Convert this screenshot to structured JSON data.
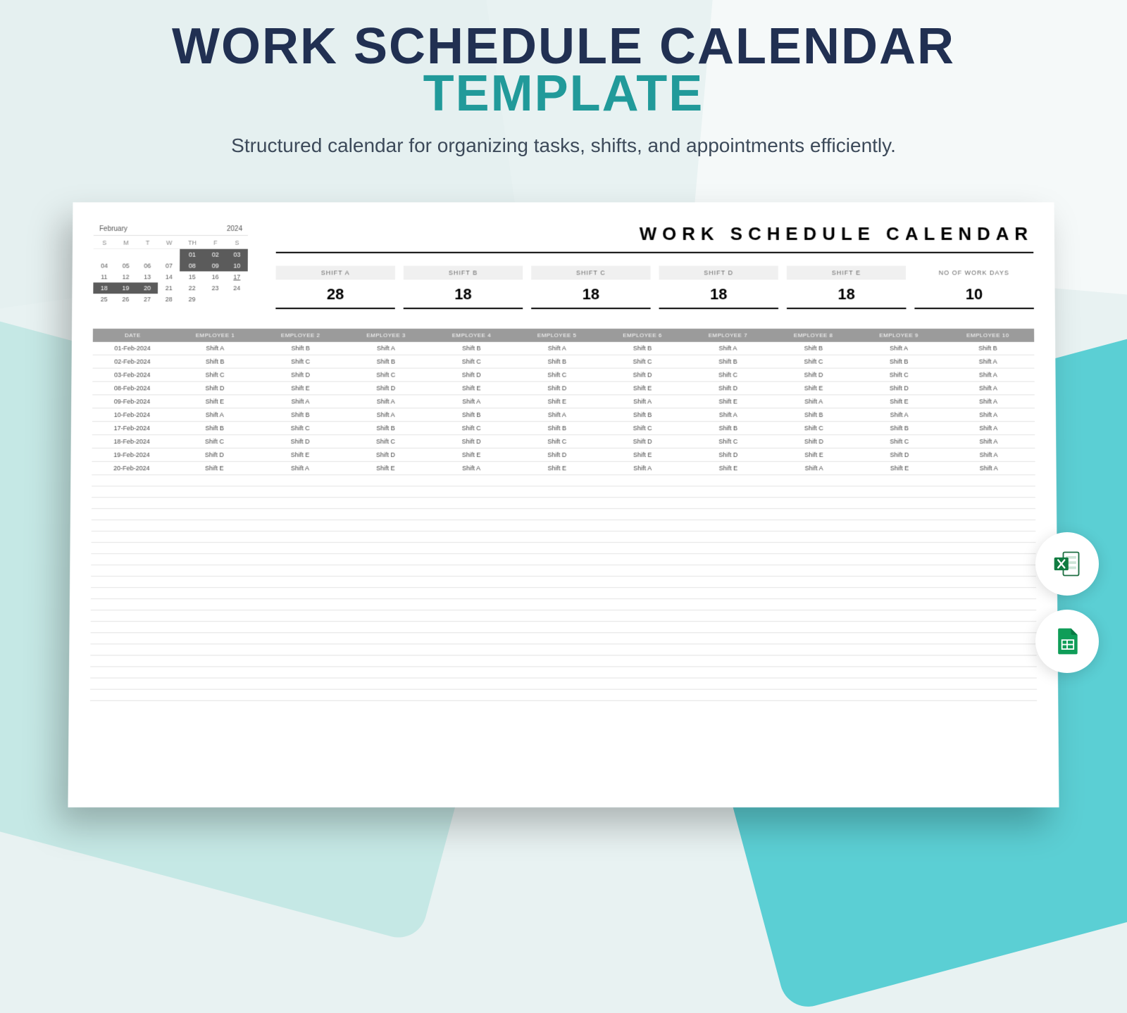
{
  "hero": {
    "line1": "WORK SCHEDULE CALENDAR",
    "line2": "TEMPLATE",
    "subtitle": "Structured calendar for organizing tasks, shifts, and appointments efficiently."
  },
  "mini_calendar": {
    "month": "February",
    "year": "2024",
    "days": [
      "S",
      "M",
      "T",
      "W",
      "TH",
      "F",
      "S"
    ],
    "weeks": [
      [
        {
          "t": ""
        },
        {
          "t": ""
        },
        {
          "t": ""
        },
        {
          "t": ""
        },
        {
          "t": "01",
          "d": true
        },
        {
          "t": "02",
          "d": true
        },
        {
          "t": "03",
          "d": true
        }
      ],
      [
        {
          "t": "04"
        },
        {
          "t": "05"
        },
        {
          "t": "06"
        },
        {
          "t": "07"
        },
        {
          "t": "08",
          "d": true
        },
        {
          "t": "09",
          "d": true
        },
        {
          "t": "10",
          "d": true
        }
      ],
      [
        {
          "t": "11"
        },
        {
          "t": "12"
        },
        {
          "t": "13"
        },
        {
          "t": "14"
        },
        {
          "t": "15"
        },
        {
          "t": "16"
        },
        {
          "t": "17",
          "u": true
        }
      ],
      [
        {
          "t": "18",
          "d": true
        },
        {
          "t": "19",
          "d": true
        },
        {
          "t": "20",
          "d": true
        },
        {
          "t": "21"
        },
        {
          "t": "22"
        },
        {
          "t": "23"
        },
        {
          "t": "24"
        }
      ],
      [
        {
          "t": "25"
        },
        {
          "t": "26"
        },
        {
          "t": "27"
        },
        {
          "t": "28"
        },
        {
          "t": "29"
        },
        {
          "t": ""
        },
        {
          "t": ""
        }
      ]
    ]
  },
  "summary": {
    "title": "WORK SCHEDULE CALENDAR",
    "boxes": [
      {
        "label": "SHIFT A",
        "value": "28"
      },
      {
        "label": "SHIFT B",
        "value": "18"
      },
      {
        "label": "SHIFT C",
        "value": "18"
      },
      {
        "label": "SHIFT D",
        "value": "18"
      },
      {
        "label": "SHIFT E",
        "value": "18"
      },
      {
        "label": "NO OF WORK DAYS",
        "value": "10"
      }
    ]
  },
  "schedule": {
    "headers": [
      "DATE",
      "EMPLOYEE 1",
      "EMPLOYEE 2",
      "EMPLOYEE 3",
      "EMPLOYEE 4",
      "EMPLOYEE 5",
      "EMPLOYEE 6",
      "EMPLOYEE 7",
      "EMPLOYEE 8",
      "EMPLOYEE 9",
      "EMPLOYEE 10"
    ],
    "rows": [
      [
        "01-Feb-2024",
        "Shift A",
        "Shift B",
        "Shift A",
        "Shift B",
        "Shift A",
        "Shift B",
        "Shift A",
        "Shift B",
        "Shift A",
        "Shift B"
      ],
      [
        "02-Feb-2024",
        "Shift B",
        "Shift C",
        "Shift B",
        "Shift C",
        "Shift B",
        "Shift C",
        "Shift B",
        "Shift C",
        "Shift B",
        "Shift A"
      ],
      [
        "03-Feb-2024",
        "Shift C",
        "Shift D",
        "Shift C",
        "Shift D",
        "Shift C",
        "Shift D",
        "Shift C",
        "Shift D",
        "Shift C",
        "Shift A"
      ],
      [
        "08-Feb-2024",
        "Shift D",
        "Shift E",
        "Shift D",
        "Shift E",
        "Shift D",
        "Shift E",
        "Shift D",
        "Shift E",
        "Shift D",
        "Shift A"
      ],
      [
        "09-Feb-2024",
        "Shift E",
        "Shift A",
        "Shift A",
        "Shift A",
        "Shift E",
        "Shift A",
        "Shift E",
        "Shift A",
        "Shift E",
        "Shift A"
      ],
      [
        "10-Feb-2024",
        "Shift A",
        "Shift B",
        "Shift A",
        "Shift B",
        "Shift A",
        "Shift B",
        "Shift A",
        "Shift B",
        "Shift A",
        "Shift A"
      ],
      [
        "17-Feb-2024",
        "Shift B",
        "Shift C",
        "Shift B",
        "Shift C",
        "Shift B",
        "Shift C",
        "Shift B",
        "Shift C",
        "Shift B",
        "Shift A"
      ],
      [
        "18-Feb-2024",
        "Shift C",
        "Shift D",
        "Shift C",
        "Shift D",
        "Shift C",
        "Shift D",
        "Shift C",
        "Shift D",
        "Shift C",
        "Shift A"
      ],
      [
        "19-Feb-2024",
        "Shift D",
        "Shift E",
        "Shift D",
        "Shift E",
        "Shift D",
        "Shift E",
        "Shift D",
        "Shift E",
        "Shift D",
        "Shift A"
      ],
      [
        "20-Feb-2024",
        "Shift E",
        "Shift A",
        "Shift E",
        "Shift A",
        "Shift E",
        "Shift A",
        "Shift E",
        "Shift A",
        "Shift E",
        "Shift A"
      ]
    ],
    "empty_rows": 20
  },
  "icons": {
    "excel": "excel-icon",
    "sheets": "sheets-icon"
  }
}
